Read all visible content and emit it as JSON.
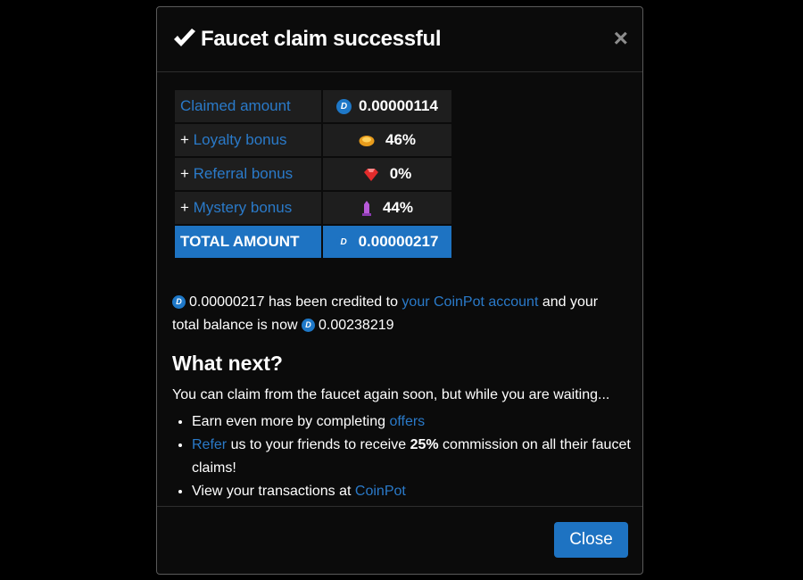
{
  "modal": {
    "title": "Faucet claim successful",
    "close_glyph": "×",
    "icons": {
      "title": "checkmark-icon",
      "close": "close-icon"
    }
  },
  "claim_table": [
    {
      "prefix": "",
      "label": "Claimed amount",
      "icon": "dash-coin-icon",
      "value": "0.00000114"
    },
    {
      "prefix": "+ ",
      "label": "Loyalty bonus",
      "icon": "loyalty-gem-icon",
      "value": "46%"
    },
    {
      "prefix": "+ ",
      "label": "Referral bonus",
      "icon": "ruby-icon",
      "value": "0%"
    },
    {
      "prefix": "+ ",
      "label": "Mystery bonus",
      "icon": "crystal-icon",
      "value": "44%"
    },
    {
      "prefix": "",
      "label": "TOTAL AMOUNT",
      "icon": "dash-coin-icon",
      "value": "0.00000217"
    }
  ],
  "credit": {
    "amount": "0.00000217",
    "text1": " has been credited to ",
    "link": "your CoinPot account",
    "text2": " and your total balance is now ",
    "balance": "0.00238219"
  },
  "next": {
    "title": "What next?",
    "intro": "You can claim from the faucet again soon, but while you are waiting...",
    "item1_text": "Earn even more by completing ",
    "item1_link": "offers",
    "item2_link": "Refer",
    "item2_text": " us to your friends to receive ",
    "item2_bold": "25%",
    "item2_text2": " commission on all their faucet claims!",
    "item3_text": "View your transactions at ",
    "item3_link": "CoinPot"
  },
  "footer": {
    "close_label": "Close"
  },
  "colors": {
    "accent": "#1e73c2",
    "link": "#2a7ac9",
    "background": "#0b0b0b"
  }
}
